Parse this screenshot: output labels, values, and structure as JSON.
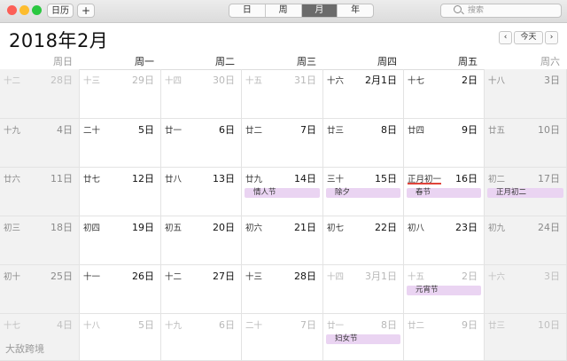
{
  "toolbar": {
    "sidebar_button": "日历",
    "add_button": "+",
    "views": [
      "日",
      "周",
      "月",
      "年"
    ],
    "active_view": "月",
    "search_placeholder": "搜索"
  },
  "header": {
    "title": "2018年2月",
    "prev": "‹",
    "today": "今天",
    "next": "›"
  },
  "weekdays": [
    "周日",
    "周一",
    "周二",
    "周三",
    "周四",
    "周五",
    "周六"
  ],
  "weeks": [
    [
      {
        "lunar": "十二",
        "solar": "28日",
        "dim": true
      },
      {
        "lunar": "十三",
        "solar": "29日",
        "dim": true
      },
      {
        "lunar": "十四",
        "solar": "30日",
        "dim": true
      },
      {
        "lunar": "十五",
        "solar": "31日",
        "dim": true
      },
      {
        "lunar": "十六",
        "solar": "2月1日"
      },
      {
        "lunar": "十七",
        "solar": "2日"
      },
      {
        "lunar": "十八",
        "solar": "3日"
      }
    ],
    [
      {
        "lunar": "十九",
        "solar": "4日"
      },
      {
        "lunar": "二十",
        "solar": "5日"
      },
      {
        "lunar": "廿一",
        "solar": "6日"
      },
      {
        "lunar": "廿二",
        "solar": "7日"
      },
      {
        "lunar": "廿三",
        "solar": "8日"
      },
      {
        "lunar": "廿四",
        "solar": "9日"
      },
      {
        "lunar": "廿五",
        "solar": "10日"
      }
    ],
    [
      {
        "lunar": "廿六",
        "solar": "11日"
      },
      {
        "lunar": "廿七",
        "solar": "12日"
      },
      {
        "lunar": "廿八",
        "solar": "13日"
      },
      {
        "lunar": "廿九",
        "solar": "14日",
        "event": "情人节"
      },
      {
        "lunar": "三十",
        "solar": "15日",
        "event": "除夕"
      },
      {
        "lunar": "正月初一",
        "solar": "16日",
        "event": "春节",
        "today": true
      },
      {
        "lunar": "初二",
        "solar": "17日",
        "event": "正月初二"
      }
    ],
    [
      {
        "lunar": "初三",
        "solar": "18日"
      },
      {
        "lunar": "初四",
        "solar": "19日"
      },
      {
        "lunar": "初五",
        "solar": "20日"
      },
      {
        "lunar": "初六",
        "solar": "21日"
      },
      {
        "lunar": "初七",
        "solar": "22日"
      },
      {
        "lunar": "初八",
        "solar": "23日"
      },
      {
        "lunar": "初九",
        "solar": "24日"
      }
    ],
    [
      {
        "lunar": "初十",
        "solar": "25日"
      },
      {
        "lunar": "十一",
        "solar": "26日"
      },
      {
        "lunar": "十二",
        "solar": "27日"
      },
      {
        "lunar": "十三",
        "solar": "28日"
      },
      {
        "lunar": "十四",
        "solar": "3月1日",
        "dim": true
      },
      {
        "lunar": "十五",
        "solar": "2日",
        "dim": true,
        "event": "元宵节"
      },
      {
        "lunar": "十六",
        "solar": "3日",
        "dim": true
      }
    ],
    [
      {
        "lunar": "十七",
        "solar": "4日",
        "dim": true
      },
      {
        "lunar": "十八",
        "solar": "5日",
        "dim": true
      },
      {
        "lunar": "十九",
        "solar": "6日",
        "dim": true
      },
      {
        "lunar": "二十",
        "solar": "7日",
        "dim": true
      },
      {
        "lunar": "廿一",
        "solar": "8日",
        "dim": true,
        "event": "妇女节"
      },
      {
        "lunar": "廿二",
        "solar": "9日",
        "dim": true
      },
      {
        "lunar": "廿三",
        "solar": "10日",
        "dim": true
      }
    ]
  ],
  "watermark": "大敌跨境",
  "colors": {
    "event": "#ead4f2",
    "today_underline": "#e0443a",
    "weekend_bg": "#f2f2f2"
  }
}
